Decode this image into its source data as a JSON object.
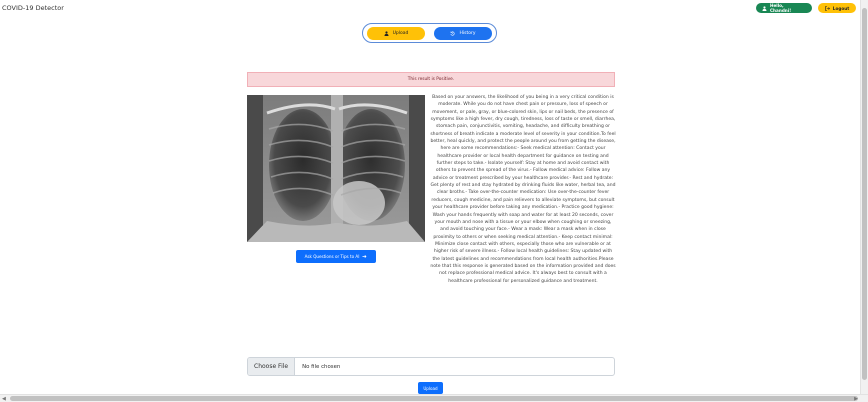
{
  "app": {
    "brand": "COVID-19 Detector"
  },
  "nav": {
    "user_label": "Hello, Chandni!",
    "logout_label": "Logout",
    "user_color": "#198754",
    "logout_color": "#ffc107"
  },
  "toggle": {
    "upload_label": "Upload",
    "history_label": "History"
  },
  "alert": {
    "text": "This result is Positive."
  },
  "ask_button": {
    "label": "Ask Questions or Tips to AI"
  },
  "response": {
    "text": "Based on your answers, the likelihood of you being in a very critical condition is moderate. While you do not have chest pain or pressure, loss of speech or movement, or pale, gray, or blue-colored skin, lips or nail beds, the presence of symptoms like a high fever, dry cough, tiredness, loss of taste or smell, diarrhea, stomach pain, conjunctivitis, vomiting, headache, and difficulty breathing or shortness of breath indicate a moderate level of severity in your condition.To feel better, heal quickly, and protect the people around you from getting the disease, here are some recommendations:- Seek medical attention: Contact your healthcare provider or local health department for guidance on testing and further steps to take.- Isolate yourself: Stay at home and avoid contact with others to prevent the spread of the virus.- Follow medical advice: Follow any advice or treatment prescribed by your healthcare provider.- Rest and hydrate: Get plenty of rest and stay hydrated by drinking fluids like water, herbal tea, and clear broths.- Take over-the-counter medication: Use over-the-counter fever reducers, cough medicine, and pain relievers to alleviate symptoms, but consult your healthcare provider before taking any medication.- Practice good hygiene: Wash your hands frequently with soap and water for at least 20 seconds, cover your mouth and nose with a tissue or your elbow when coughing or sneezing, and avoid touching your face.- Wear a mask: Wear a mask when in close proximity to others or when seeking medical attention.- Keep contact minimal: Minimize close contact with others, especially those who are vulnerable or at higher risk of severe illness.- Follow local health guidelines: Stay updated with the latest guidelines and recommendations from local health authorities.Please note that this response is generated based on the information provided and does not replace professional medical advice. It's always best to consult with a healthcare professional for personalized guidance and treatment."
  },
  "file_input": {
    "choose_label": "Choose File",
    "status": "No file chosen"
  },
  "submit": {
    "label": "Upload"
  }
}
